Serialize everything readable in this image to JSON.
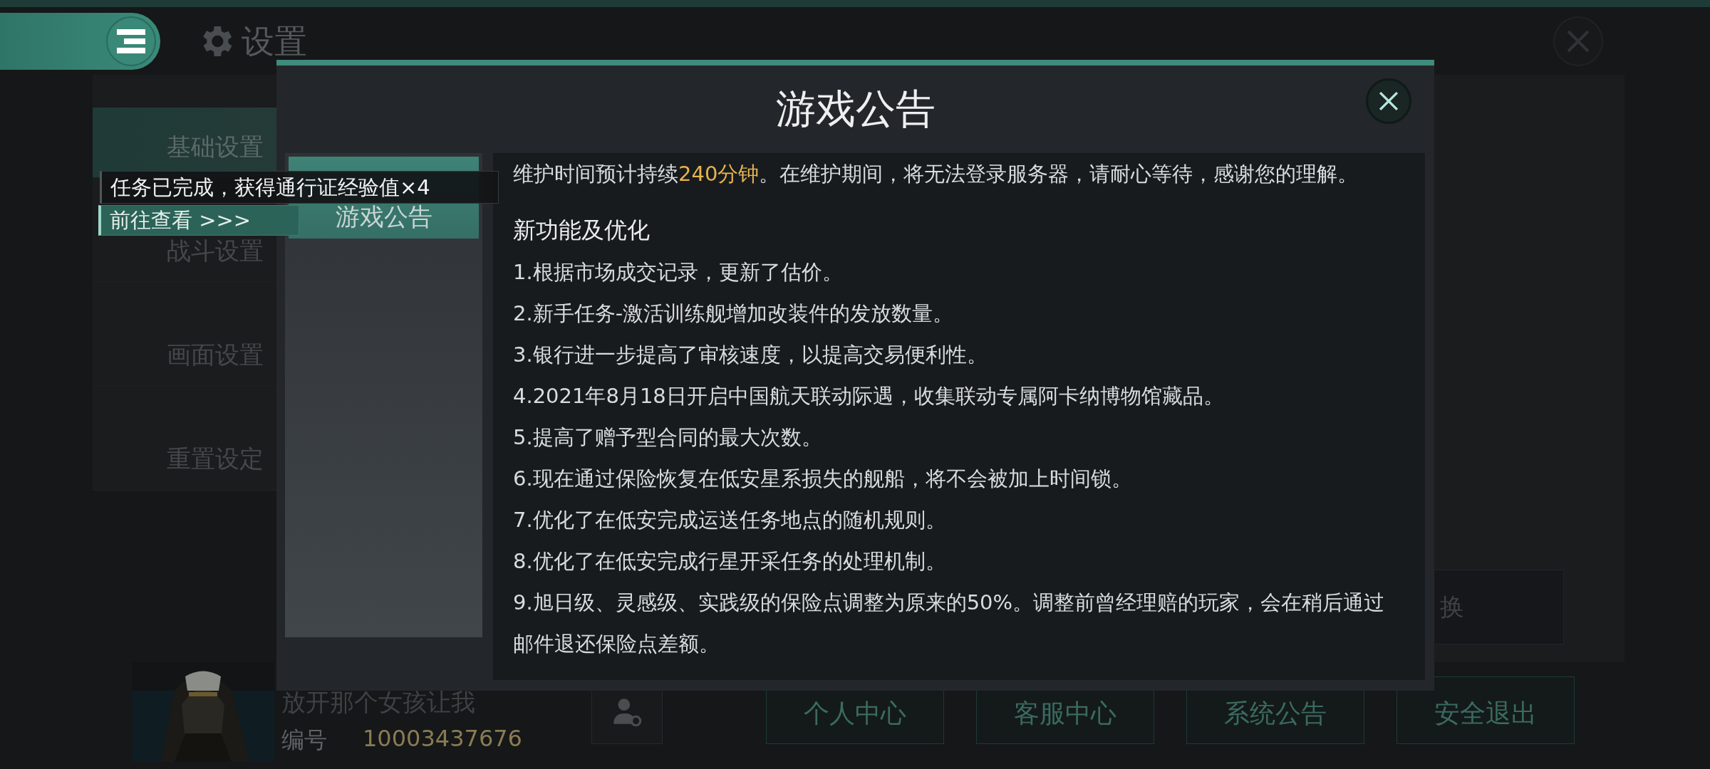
{
  "header": {
    "title": "设置"
  },
  "nav": {
    "items": [
      {
        "label": "基础设置",
        "selected": true
      },
      {
        "label": "战斗设置",
        "selected": false
      },
      {
        "label": "画面设置",
        "selected": false
      },
      {
        "label": "重置设定",
        "selected": false
      }
    ]
  },
  "settings_panel": {
    "button_fragment": "换"
  },
  "profile": {
    "name": "放开那个女孩让我",
    "id_label": "编号",
    "id": "10003437676"
  },
  "footer_buttons": [
    "个人中心",
    "客服中心",
    "系统公告",
    "安全退出"
  ],
  "dialog": {
    "title": "游戏公告",
    "tabs": [
      {
        "label": "游戏公告",
        "selected": true
      }
    ],
    "intro": [
      {
        "text": "维护时间预计持续",
        "highlight": false
      },
      {
        "text": "240分钟",
        "highlight": true
      },
      {
        "text": "。在维护期间，将无法登录服务器，请耐心等待，感谢您的理解。",
        "highlight": false
      }
    ],
    "heading": "新功能及优化",
    "items": [
      "1.根据市场成交记录，更新了估价。",
      "2.新手任务-激活训练舰增加改装件的发放数量。",
      "3.银行进一步提高了审核速度，以提高交易便利性。",
      "4.2021年8月18日开启中国航天联动际遇，收集联动专属阿卡纳博物馆藏品。",
      "5.提高了赠予型合同的最大次数。",
      "6.现在通过保险恢复在低安星系损失的舰船，将不会被加上时间锁。",
      "7.优化了在低安完成运送任务地点的随机规则。",
      "8.优化了在低安完成行星开采任务的处理机制。",
      "9.旭日级、灵感级、实践级的保险点调整为原来的50%。调整前曾经理赔的玩家，会在稍后通过邮件退还保险点差额。"
    ]
  },
  "toast": {
    "message": "任务已完成，获得通行证经验值×4",
    "link": "前往查看 >>>"
  }
}
